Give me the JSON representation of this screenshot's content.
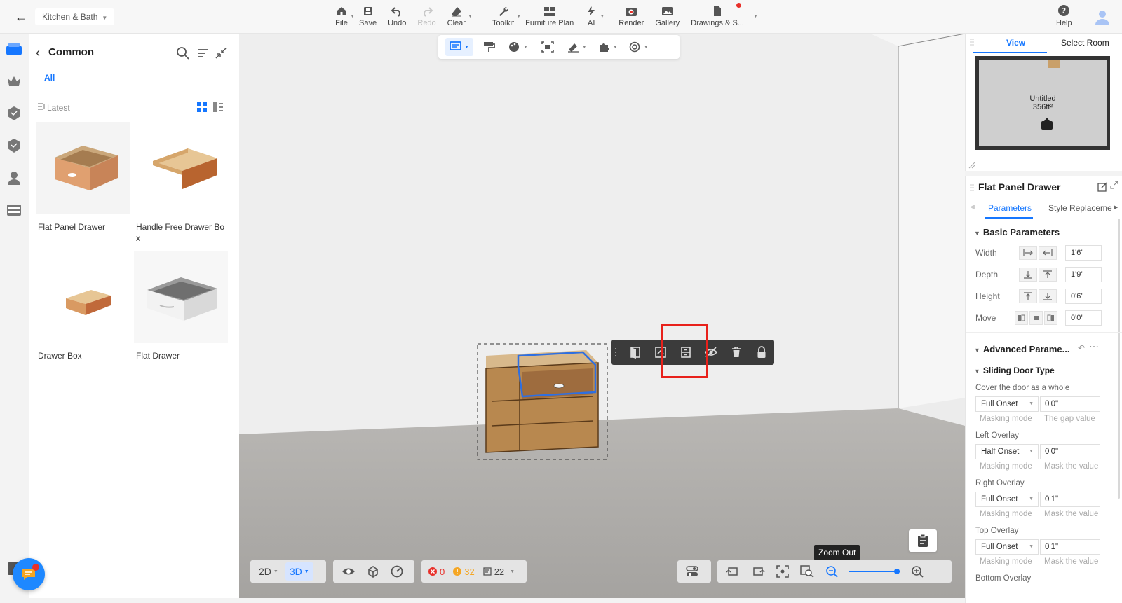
{
  "header": {
    "project_name": "Kitchen & Bath",
    "tools": [
      {
        "label": "File",
        "icon": "home-icon",
        "dropdown": true
      },
      {
        "label": "Save",
        "icon": "save-icon"
      },
      {
        "label": "Undo",
        "icon": "undo-icon"
      },
      {
        "label": "Redo",
        "icon": "redo-icon",
        "disabled": true
      },
      {
        "label": "Clear",
        "icon": "eraser-icon",
        "dropdown": true
      },
      {
        "label": "Toolkit",
        "icon": "wrench-icon",
        "dropdown": true
      },
      {
        "label": "Furniture Plan",
        "icon": "plan-icon"
      },
      {
        "label": "AI",
        "icon": "ai-icon",
        "dropdown": true
      },
      {
        "label": "Render",
        "icon": "camera-icon"
      },
      {
        "label": "Gallery",
        "icon": "gallery-icon"
      },
      {
        "label": "Drawings & S...",
        "icon": "drawings-icon",
        "dropdown": true,
        "notification": true
      }
    ],
    "help_label": "Help"
  },
  "catalog": {
    "title": "Common",
    "tab_all": "All",
    "sort_label": "Latest",
    "items": [
      {
        "name": "Flat Panel Drawer"
      },
      {
        "name": "Handle Free Drawer Box"
      },
      {
        "name": "Drawer Box"
      },
      {
        "name": "Flat Drawer"
      }
    ]
  },
  "viewport": {
    "bottom_left": {
      "mode_2d": "2D",
      "mode_3d": "3D"
    },
    "status": {
      "errors": "0",
      "warnings": "32",
      "items": "22"
    },
    "zoom_tooltip": "Zoom Out",
    "zoom_level": 0.95
  },
  "minimap": {
    "tab_view": "View",
    "tab_select_room": "Select Room",
    "room_name": "Untitled",
    "room_area": "356ft²"
  },
  "properties": {
    "title": "Flat Panel Drawer",
    "tab_parameters": "Parameters",
    "tab_style": "Style Replaceme",
    "basic_title": "Basic Parameters",
    "width_label": "Width",
    "width_value": "1'6\"",
    "depth_label": "Depth",
    "depth_value": "1'9\"",
    "height_label": "Height",
    "height_value": "0'6\"",
    "move_label": "Move",
    "move_value": "0'0\"",
    "advanced_title": "Advanced Parame...",
    "sliding_title": "Sliding Door Type",
    "cover_label": "Cover the door as a whole",
    "cover_select": "Full Onset",
    "cover_value": "0'0\"",
    "cover_hint_1": "Masking mode",
    "cover_hint_2": "The gap value",
    "left_label": "Left Overlay",
    "left_select": "Half Onset",
    "left_value": "0'0\"",
    "left_hint_1": "Masking mode",
    "left_hint_2": "Mask the value",
    "right_label": "Right Overlay",
    "right_select": "Full Onset",
    "right_value": "0'1\"",
    "right_hint_1": "Masking mode",
    "right_hint_2": "Mask the value",
    "top_label": "Top Overlay",
    "top_select": "Full Onset",
    "top_value": "0'1\"",
    "top_hint_1": "Masking mode",
    "top_hint_2": "Mask the value",
    "bottom_label": "Bottom Overlay"
  },
  "colors": {
    "accent": "#1677ff",
    "highlight_box": "#e8211b",
    "error": "#e8302a",
    "warning": "#f5a623"
  }
}
